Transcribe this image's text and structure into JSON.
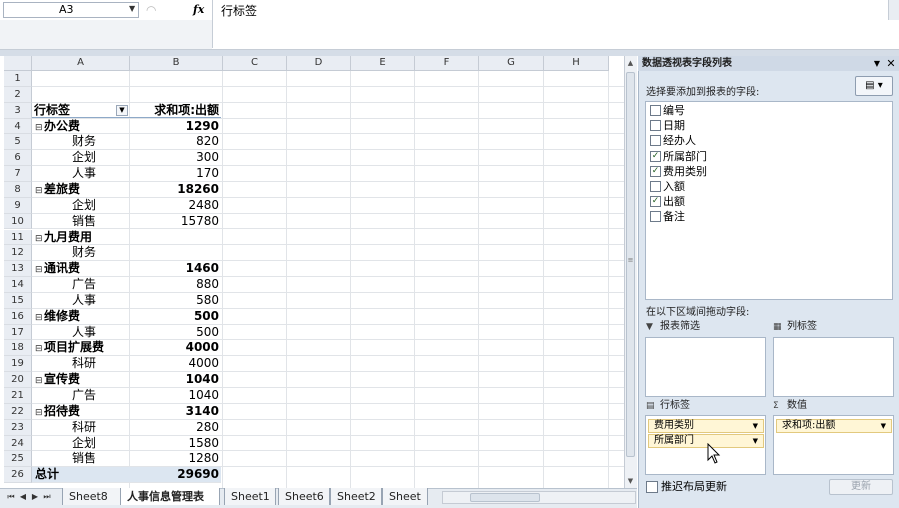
{
  "formula_bar": {
    "name_box": "A3",
    "fx_label": "fx",
    "formula": "行标签"
  },
  "columns": [
    "A",
    "B",
    "C",
    "D",
    "E",
    "F",
    "G",
    "H"
  ],
  "row_numbers": [
    "1",
    "2",
    "3",
    "4",
    "5",
    "6",
    "7",
    "8",
    "9",
    "10",
    "11",
    "12",
    "13",
    "14",
    "15",
    "16",
    "17",
    "18",
    "19",
    "20",
    "21",
    "22",
    "23",
    "24",
    "25",
    "26"
  ],
  "pivot_table": {
    "header_row_label": "行标签",
    "header_value_label": "求和项:出额",
    "rows": [
      {
        "label": "办公费",
        "value": "1290",
        "level": 0
      },
      {
        "label": "财务",
        "value": "820",
        "level": 1
      },
      {
        "label": "企划",
        "value": "300",
        "level": 1
      },
      {
        "label": "人事",
        "value": "170",
        "level": 1
      },
      {
        "label": "差旅费",
        "value": "18260",
        "level": 0
      },
      {
        "label": "企划",
        "value": "2480",
        "level": 1
      },
      {
        "label": "销售",
        "value": "15780",
        "level": 1
      },
      {
        "label": "九月费用",
        "value": "",
        "level": 0
      },
      {
        "label": "财务",
        "value": "",
        "level": 1
      },
      {
        "label": "通讯费",
        "value": "1460",
        "level": 0
      },
      {
        "label": "广告",
        "value": "880",
        "level": 1
      },
      {
        "label": "人事",
        "value": "580",
        "level": 1
      },
      {
        "label": "维修费",
        "value": "500",
        "level": 0
      },
      {
        "label": "人事",
        "value": "500",
        "level": 1
      },
      {
        "label": "项目扩展费",
        "value": "4000",
        "level": 0
      },
      {
        "label": "科研",
        "value": "4000",
        "level": 1
      },
      {
        "label": "宣传费",
        "value": "1040",
        "level": 0
      },
      {
        "label": "广告",
        "value": "1040",
        "level": 1
      },
      {
        "label": "招待费",
        "value": "3140",
        "level": 0
      },
      {
        "label": "科研",
        "value": "280",
        "level": 1
      },
      {
        "label": "企划",
        "value": "1580",
        "level": 1
      },
      {
        "label": "销售",
        "value": "1280",
        "level": 1
      }
    ],
    "total_label": "总计",
    "total_value": "29690"
  },
  "sheet_tabs": [
    "Sheet8",
    "人事信息管理表",
    "Sheet1",
    "Sheet6",
    "Sheet2",
    "Sheet"
  ],
  "active_sheet": "人事信息管理表",
  "pivot_panel": {
    "title": "数据透视表字段列表",
    "choose_label": "选择要添加到报表的字段:",
    "fields": [
      {
        "name": "编号",
        "checked": false
      },
      {
        "name": "日期",
        "checked": false
      },
      {
        "name": "经办人",
        "checked": false
      },
      {
        "name": "所属部门",
        "checked": true
      },
      {
        "name": "费用类别",
        "checked": true
      },
      {
        "name": "入额",
        "checked": false
      },
      {
        "name": "出额",
        "checked": true
      },
      {
        "name": "备注",
        "checked": false
      }
    ],
    "drag_label": "在以下区域间拖动字段:",
    "area_filter": "报表筛选",
    "area_columns": "列标签",
    "area_rows": "行标签",
    "area_values": "数值",
    "row_chips": [
      "费用类别",
      "所属部门"
    ],
    "value_chips": [
      "求和项:出额"
    ],
    "defer_label": "推迟布局更新",
    "update_button": "更新"
  },
  "colors": {
    "header_bg": "#e9edf3",
    "panel_bg": "#dde6f0",
    "total_bg": "#dce6f1",
    "chip_bg": "#fff6d6"
  }
}
